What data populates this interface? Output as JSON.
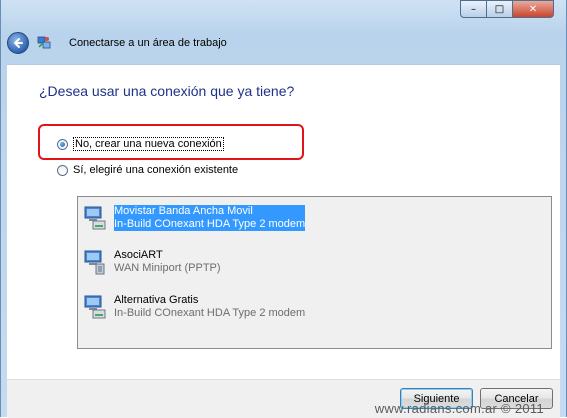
{
  "window": {
    "title": "Conectarse a un área de trabajo",
    "minimize_glyph": "–",
    "maximize_glyph": "□",
    "close_glyph": "✕"
  },
  "main": {
    "question": "¿Desea usar una conexión que ya tiene?",
    "options": [
      {
        "label": "No, crear una nueva conexión",
        "checked": true
      },
      {
        "label": "Sí, elegiré una conexión existente",
        "checked": false
      }
    ],
    "connections": [
      {
        "name": "Movistar Banda Ancha Movil",
        "device": "In-Build COnexant HDA Type 2 modem",
        "selected": true,
        "icon": "modem-connection-icon"
      },
      {
        "name": "AsociART",
        "device": "WAN Miniport (PPTP)",
        "selected": false,
        "icon": "vpn-connection-icon"
      },
      {
        "name": "Alternativa Gratis",
        "device": "In-Build COnexant HDA Type 2 modem",
        "selected": false,
        "icon": "modem-connection-icon"
      }
    ]
  },
  "footer": {
    "next_label": "Siguiente",
    "cancel_label": "Cancelar",
    "watermark": "www.radians.com.ar © 2011"
  },
  "colors": {
    "heading": "#1e3287",
    "selection": "#3399ff",
    "highlight_border": "#e0141b"
  }
}
